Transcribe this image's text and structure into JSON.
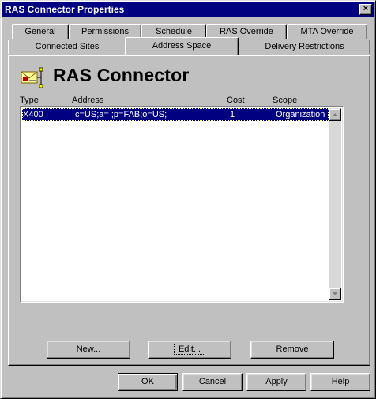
{
  "window": {
    "title": "RAS Connector Properties",
    "close_glyph": "×"
  },
  "tabs_back": [
    {
      "label": "General"
    },
    {
      "label": "Permissions"
    },
    {
      "label": "Schedule"
    },
    {
      "label": "RAS Override"
    },
    {
      "label": "MTA Override"
    }
  ],
  "tabs_front": [
    {
      "label": "Connected Sites"
    },
    {
      "label": "Address Space"
    },
    {
      "label": "Delivery Restrictions"
    }
  ],
  "active_tab": "Address Space",
  "header": {
    "title": "RAS Connector",
    "icon": "connector-envelope-icon"
  },
  "columns": {
    "type": "Type",
    "address": "Address",
    "cost": "Cost",
    "scope": "Scope"
  },
  "rows": [
    {
      "type": "X400",
      "address": "c=US;a= ;p=FAB;o=US;",
      "cost": "1",
      "scope": "Organization",
      "selected": true
    }
  ],
  "list_buttons": {
    "new": "New...",
    "edit": "Edit...",
    "remove": "Remove"
  },
  "dialog_buttons": {
    "ok": "OK",
    "cancel": "Cancel",
    "apply": "Apply",
    "help": "Help"
  },
  "colors": {
    "title_bar": "#000080",
    "selection": "#000080",
    "face": "#c0c0c0"
  }
}
